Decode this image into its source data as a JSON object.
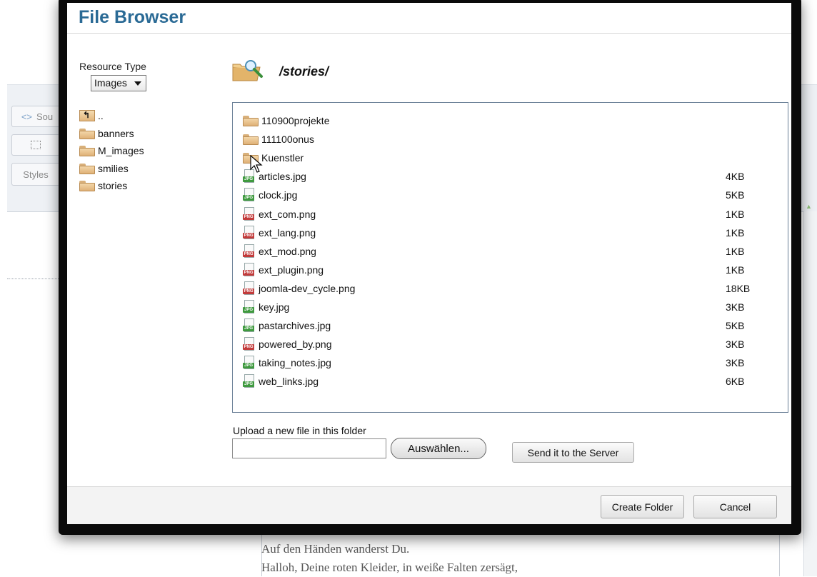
{
  "background": {
    "toolbar_buttons": [
      "Sou",
      "Styles"
    ],
    "editor_lines": [
      "Auf den Händen wanderst Du.",
      "Halloh, Deine roten Kleider, in weiße Falten zersägt,"
    ]
  },
  "dialog": {
    "title": "File Browser",
    "resource_type_label": "Resource Type",
    "resource_type_value": "Images",
    "current_path": "/stories/"
  },
  "folder_tree": [
    {
      "label": "..",
      "icon": "folder-up-icon"
    },
    {
      "label": "banners",
      "icon": "folder-icon"
    },
    {
      "label": "M_images",
      "icon": "folder-icon"
    },
    {
      "label": "smilies",
      "icon": "folder-icon"
    },
    {
      "label": "stories",
      "icon": "folder-open-icon"
    }
  ],
  "files": [
    {
      "name": "110900projekte",
      "type": "folder",
      "size": ""
    },
    {
      "name": "111100onus",
      "type": "folder",
      "size": ""
    },
    {
      "name": "Kuenstler",
      "type": "folder",
      "size": ""
    },
    {
      "name": "articles.jpg",
      "type": "jpg",
      "size": "4KB"
    },
    {
      "name": "clock.jpg",
      "type": "jpg",
      "size": "5KB"
    },
    {
      "name": "ext_com.png",
      "type": "png",
      "size": "1KB"
    },
    {
      "name": "ext_lang.png",
      "type": "png",
      "size": "1KB"
    },
    {
      "name": "ext_mod.png",
      "type": "png",
      "size": "1KB"
    },
    {
      "name": "ext_plugin.png",
      "type": "png",
      "size": "1KB"
    },
    {
      "name": "joomla-dev_cycle.png",
      "type": "png",
      "size": "18KB"
    },
    {
      "name": "key.jpg",
      "type": "jpg",
      "size": "3KB"
    },
    {
      "name": "pastarchives.jpg",
      "type": "jpg",
      "size": "5KB"
    },
    {
      "name": "powered_by.png",
      "type": "png",
      "size": "3KB"
    },
    {
      "name": "taking_notes.jpg",
      "type": "jpg",
      "size": "3KB"
    },
    {
      "name": "web_links.jpg",
      "type": "jpg",
      "size": "6KB"
    }
  ],
  "upload": {
    "label": "Upload a new file in this folder",
    "browse_label": "Auswählen...",
    "send_label": "Send it to the Server"
  },
  "footer": {
    "create_folder_label": "Create Folder",
    "cancel_label": "Cancel"
  },
  "colors": {
    "title": "#2a6a95",
    "jpg_badge": "#3f9a3f",
    "png_badge": "#c23b3b"
  }
}
